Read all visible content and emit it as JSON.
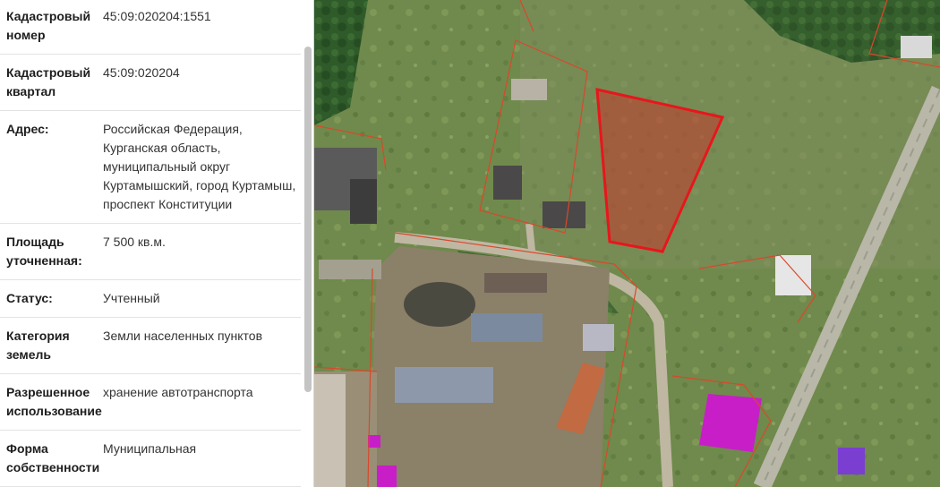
{
  "info": {
    "rows": [
      {
        "label": "Кадастровый номер",
        "value": "45:09:020204:1551"
      },
      {
        "label": "Кадастровый квартал",
        "value": "45:09:020204"
      },
      {
        "label": "Адрес:",
        "value": "Российская Федерация, Курганская область, муниципальный округ Куртамышский, город Куртамыш, проспект Конституции"
      },
      {
        "label": "Площадь уточненная:",
        "value": "7 500 кв.м."
      },
      {
        "label": "Статус:",
        "value": "Учтенный"
      },
      {
        "label": "Категория земель",
        "value": "Земли населенных пунктов"
      },
      {
        "label": "Разрешенное использование",
        "value": "хранение автотранспорта"
      },
      {
        "label": "Форма собственности",
        "value": "Муниципальная"
      }
    ]
  },
  "map": {
    "selected_parcel_color": "#e8161b",
    "boundary_color": "#d9482b",
    "magenta_roof_color": "#c81ec8"
  }
}
